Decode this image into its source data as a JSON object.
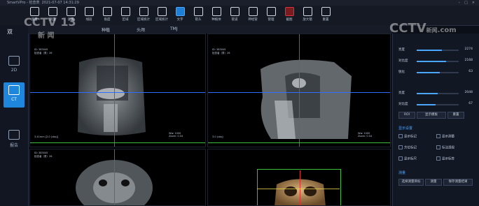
{
  "app": {
    "title": "SmartVPro - 检查表",
    "timestamp": "2021-07-07 14:31:29"
  },
  "toolbar": {
    "tools": [
      {
        "label": "测量",
        "icon": "search-icon"
      },
      {
        "label": "测量",
        "icon": "zoom-icon"
      },
      {
        "label": "设置",
        "icon": "gear-icon"
      },
      {
        "label": "线段",
        "icon": "pen-icon"
      },
      {
        "label": "角度",
        "icon": "angle-icon"
      },
      {
        "label": "区域",
        "icon": "area-icon"
      },
      {
        "label": "区域统计",
        "icon": "region-stats-icon"
      },
      {
        "label": "区域统计",
        "icon": "globe-icon"
      },
      {
        "label": "文字",
        "icon": "text-icon"
      },
      {
        "label": "箭头",
        "icon": "arrow-icon"
      },
      {
        "label": "种植体",
        "icon": "implant-icon"
      },
      {
        "label": "管道",
        "icon": "tube-icon"
      },
      {
        "label": "神经管",
        "icon": "nerve-icon"
      },
      {
        "label": "管理",
        "icon": "manage-icon"
      },
      {
        "label": "截图",
        "icon": "record-icon"
      },
      {
        "label": "放大镜",
        "icon": "magnifier-icon"
      },
      {
        "label": "重置",
        "icon": "refresh-icon"
      }
    ]
  },
  "sidebar": {
    "logo": "双",
    "items": [
      {
        "label": "2D",
        "icon": "2d-icon"
      },
      {
        "label": "CT",
        "icon": "ct-icon"
      },
      {
        "label": "报告",
        "icon": "report-icon"
      }
    ]
  },
  "subtabs": [
    "种植",
    "头颅",
    "TMJ"
  ],
  "panes": {
    "coronal": {
      "id": "ID: 383045",
      "name": "检查者（男）26",
      "scale": "3.41mm [2.0 (cbq)]",
      "coords": "Ww: 1000\nZoom: 0.54"
    },
    "sagittal": {
      "id": "ID: 383045",
      "name": "检查者（男）26",
      "scale": "3.0 (cbq)",
      "coords": "Ww: 1000\nZoom: 0.54"
    },
    "axial": {
      "id": "ID: 383045",
      "name": "检查者（男）26"
    }
  },
  "rightpanel": {
    "sliders": [
      {
        "label": "亮度",
        "value": "2274",
        "level": 0.6
      },
      {
        "label": "对比度",
        "value": "2168",
        "level": 0.7
      },
      {
        "label": "锐化",
        "value": "63",
        "level": 0.55
      },
      {
        "label": "亮度",
        "value": "2048",
        "level": 0.5
      },
      {
        "label": "对比度",
        "value": "67",
        "level": 0.45
      }
    ],
    "buttons": [
      "ROI",
      "显示模板",
      "重置"
    ],
    "section1": "显示设置",
    "checks": [
      "显示标记",
      "显示测量",
      "方位标记",
      "标注透视",
      "显示标尺",
      "显示标签"
    ],
    "section2": "测量",
    "bottom_buttons": [
      "选择测量目标",
      "测量",
      "保存测量结果"
    ]
  },
  "watermark": {
    "channel1": "CCTV 13",
    "channel1_sub": "新 闻",
    "channel2": "CCTV",
    "channel2_sub": "新闻",
    "channel2_domain": ".com"
  }
}
